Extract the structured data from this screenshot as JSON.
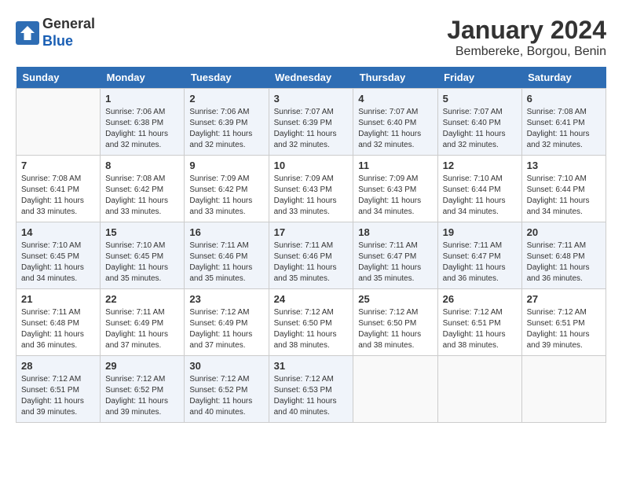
{
  "header": {
    "logo_line1": "General",
    "logo_line2": "Blue",
    "month_title": "January 2024",
    "location": "Bembereke, Borgou, Benin"
  },
  "weekdays": [
    "Sunday",
    "Monday",
    "Tuesday",
    "Wednesday",
    "Thursday",
    "Friday",
    "Saturday"
  ],
  "weeks": [
    [
      {
        "day": "",
        "sunrise": "",
        "sunset": "",
        "daylight": ""
      },
      {
        "day": "1",
        "sunrise": "Sunrise: 7:06 AM",
        "sunset": "Sunset: 6:38 PM",
        "daylight": "Daylight: 11 hours and 32 minutes."
      },
      {
        "day": "2",
        "sunrise": "Sunrise: 7:06 AM",
        "sunset": "Sunset: 6:39 PM",
        "daylight": "Daylight: 11 hours and 32 minutes."
      },
      {
        "day": "3",
        "sunrise": "Sunrise: 7:07 AM",
        "sunset": "Sunset: 6:39 PM",
        "daylight": "Daylight: 11 hours and 32 minutes."
      },
      {
        "day": "4",
        "sunrise": "Sunrise: 7:07 AM",
        "sunset": "Sunset: 6:40 PM",
        "daylight": "Daylight: 11 hours and 32 minutes."
      },
      {
        "day": "5",
        "sunrise": "Sunrise: 7:07 AM",
        "sunset": "Sunset: 6:40 PM",
        "daylight": "Daylight: 11 hours and 32 minutes."
      },
      {
        "day": "6",
        "sunrise": "Sunrise: 7:08 AM",
        "sunset": "Sunset: 6:41 PM",
        "daylight": "Daylight: 11 hours and 32 minutes."
      }
    ],
    [
      {
        "day": "7",
        "sunrise": "Sunrise: 7:08 AM",
        "sunset": "Sunset: 6:41 PM",
        "daylight": "Daylight: 11 hours and 33 minutes."
      },
      {
        "day": "8",
        "sunrise": "Sunrise: 7:08 AM",
        "sunset": "Sunset: 6:42 PM",
        "daylight": "Daylight: 11 hours and 33 minutes."
      },
      {
        "day": "9",
        "sunrise": "Sunrise: 7:09 AM",
        "sunset": "Sunset: 6:42 PM",
        "daylight": "Daylight: 11 hours and 33 minutes."
      },
      {
        "day": "10",
        "sunrise": "Sunrise: 7:09 AM",
        "sunset": "Sunset: 6:43 PM",
        "daylight": "Daylight: 11 hours and 33 minutes."
      },
      {
        "day": "11",
        "sunrise": "Sunrise: 7:09 AM",
        "sunset": "Sunset: 6:43 PM",
        "daylight": "Daylight: 11 hours and 34 minutes."
      },
      {
        "day": "12",
        "sunrise": "Sunrise: 7:10 AM",
        "sunset": "Sunset: 6:44 PM",
        "daylight": "Daylight: 11 hours and 34 minutes."
      },
      {
        "day": "13",
        "sunrise": "Sunrise: 7:10 AM",
        "sunset": "Sunset: 6:44 PM",
        "daylight": "Daylight: 11 hours and 34 minutes."
      }
    ],
    [
      {
        "day": "14",
        "sunrise": "Sunrise: 7:10 AM",
        "sunset": "Sunset: 6:45 PM",
        "daylight": "Daylight: 11 hours and 34 minutes."
      },
      {
        "day": "15",
        "sunrise": "Sunrise: 7:10 AM",
        "sunset": "Sunset: 6:45 PM",
        "daylight": "Daylight: 11 hours and 35 minutes."
      },
      {
        "day": "16",
        "sunrise": "Sunrise: 7:11 AM",
        "sunset": "Sunset: 6:46 PM",
        "daylight": "Daylight: 11 hours and 35 minutes."
      },
      {
        "day": "17",
        "sunrise": "Sunrise: 7:11 AM",
        "sunset": "Sunset: 6:46 PM",
        "daylight": "Daylight: 11 hours and 35 minutes."
      },
      {
        "day": "18",
        "sunrise": "Sunrise: 7:11 AM",
        "sunset": "Sunset: 6:47 PM",
        "daylight": "Daylight: 11 hours and 35 minutes."
      },
      {
        "day": "19",
        "sunrise": "Sunrise: 7:11 AM",
        "sunset": "Sunset: 6:47 PM",
        "daylight": "Daylight: 11 hours and 36 minutes."
      },
      {
        "day": "20",
        "sunrise": "Sunrise: 7:11 AM",
        "sunset": "Sunset: 6:48 PM",
        "daylight": "Daylight: 11 hours and 36 minutes."
      }
    ],
    [
      {
        "day": "21",
        "sunrise": "Sunrise: 7:11 AM",
        "sunset": "Sunset: 6:48 PM",
        "daylight": "Daylight: 11 hours and 36 minutes."
      },
      {
        "day": "22",
        "sunrise": "Sunrise: 7:11 AM",
        "sunset": "Sunset: 6:49 PM",
        "daylight": "Daylight: 11 hours and 37 minutes."
      },
      {
        "day": "23",
        "sunrise": "Sunrise: 7:12 AM",
        "sunset": "Sunset: 6:49 PM",
        "daylight": "Daylight: 11 hours and 37 minutes."
      },
      {
        "day": "24",
        "sunrise": "Sunrise: 7:12 AM",
        "sunset": "Sunset: 6:50 PM",
        "daylight": "Daylight: 11 hours and 38 minutes."
      },
      {
        "day": "25",
        "sunrise": "Sunrise: 7:12 AM",
        "sunset": "Sunset: 6:50 PM",
        "daylight": "Daylight: 11 hours and 38 minutes."
      },
      {
        "day": "26",
        "sunrise": "Sunrise: 7:12 AM",
        "sunset": "Sunset: 6:51 PM",
        "daylight": "Daylight: 11 hours and 38 minutes."
      },
      {
        "day": "27",
        "sunrise": "Sunrise: 7:12 AM",
        "sunset": "Sunset: 6:51 PM",
        "daylight": "Daylight: 11 hours and 39 minutes."
      }
    ],
    [
      {
        "day": "28",
        "sunrise": "Sunrise: 7:12 AM",
        "sunset": "Sunset: 6:51 PM",
        "daylight": "Daylight: 11 hours and 39 minutes."
      },
      {
        "day": "29",
        "sunrise": "Sunrise: 7:12 AM",
        "sunset": "Sunset: 6:52 PM",
        "daylight": "Daylight: 11 hours and 39 minutes."
      },
      {
        "day": "30",
        "sunrise": "Sunrise: 7:12 AM",
        "sunset": "Sunset: 6:52 PM",
        "daylight": "Daylight: 11 hours and 40 minutes."
      },
      {
        "day": "31",
        "sunrise": "Sunrise: 7:12 AM",
        "sunset": "Sunset: 6:53 PM",
        "daylight": "Daylight: 11 hours and 40 minutes."
      },
      {
        "day": "",
        "sunrise": "",
        "sunset": "",
        "daylight": ""
      },
      {
        "day": "",
        "sunrise": "",
        "sunset": "",
        "daylight": ""
      },
      {
        "day": "",
        "sunrise": "",
        "sunset": "",
        "daylight": ""
      }
    ]
  ]
}
